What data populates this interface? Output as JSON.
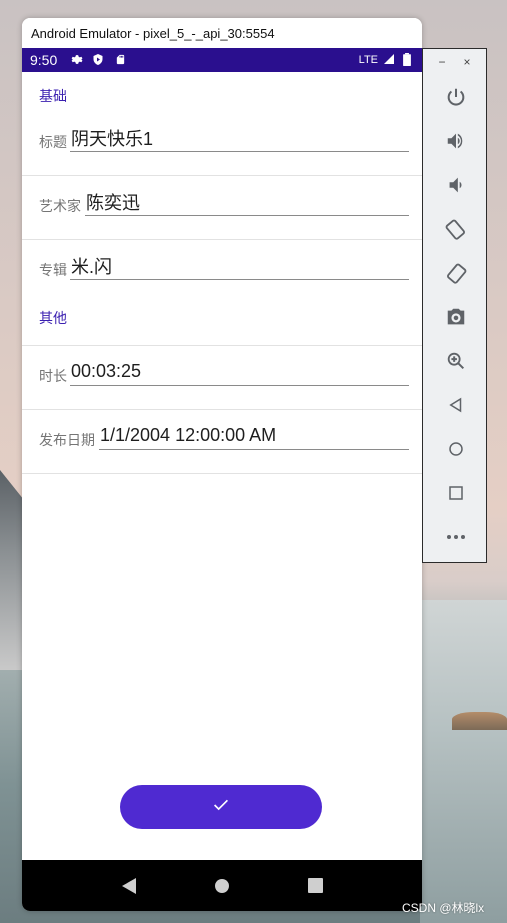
{
  "window": {
    "title": "Android Emulator - pixel_5_-_api_30:5554"
  },
  "status_bar": {
    "time": "9:50",
    "network": "LTE"
  },
  "sections": {
    "basic": {
      "header": "基础"
    },
    "other": {
      "header": "其他"
    }
  },
  "fields": {
    "title": {
      "label": "标题",
      "value": "阴天快乐1"
    },
    "artist": {
      "label": "艺术家",
      "value": "陈奕迅"
    },
    "album": {
      "label": "专辑",
      "value": "米.闪"
    },
    "duration": {
      "label": "时长",
      "value": "00:03:25"
    },
    "release_date": {
      "label": "发布日期",
      "value": "1/1/2004 12:00:00 AM"
    }
  },
  "confirm_button": {
    "icon": "check-icon"
  },
  "toolbar": {
    "minimize": "−",
    "close": "×",
    "buttons": [
      "power-icon",
      "volume-up-icon",
      "volume-down-icon",
      "rotate-left-icon",
      "rotate-right-icon",
      "camera-icon",
      "zoom-icon",
      "back-icon",
      "home-icon",
      "overview-icon",
      "more-icon"
    ]
  },
  "watermark": "CSDN @林晓lx",
  "colors": {
    "status_bar": "#2a0f8e",
    "accent": "#4f2ad1",
    "section_header": "#3a1fb0"
  }
}
